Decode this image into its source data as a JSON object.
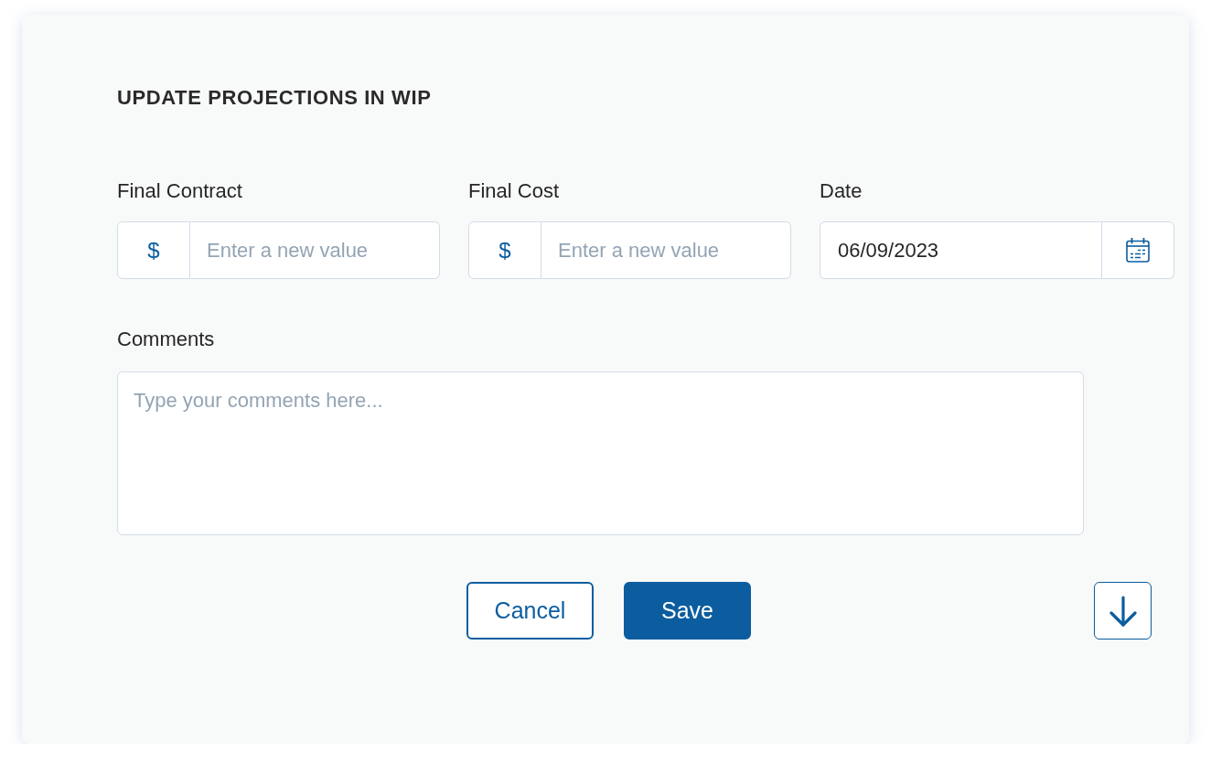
{
  "dialog": {
    "title": "UPDATE PROJECTIONS IN WIP",
    "fields": [
      {
        "kind": "currency",
        "label": "Final Contract",
        "prefix": "$",
        "placeholder": "Enter a new value"
      },
      {
        "kind": "currency",
        "label": "Final Cost",
        "prefix": "$",
        "placeholder": "Enter a new value"
      },
      {
        "kind": "date",
        "label": "Date",
        "value": "06/09/2023"
      }
    ],
    "comments": {
      "label": "Comments",
      "placeholder": "Type your comments here..."
    },
    "buttons": [
      {
        "kind": "secondary",
        "label": "Cancel"
      },
      {
        "kind": "primary",
        "label": "Save"
      },
      {
        "kind": "scroll"
      }
    ]
  }
}
